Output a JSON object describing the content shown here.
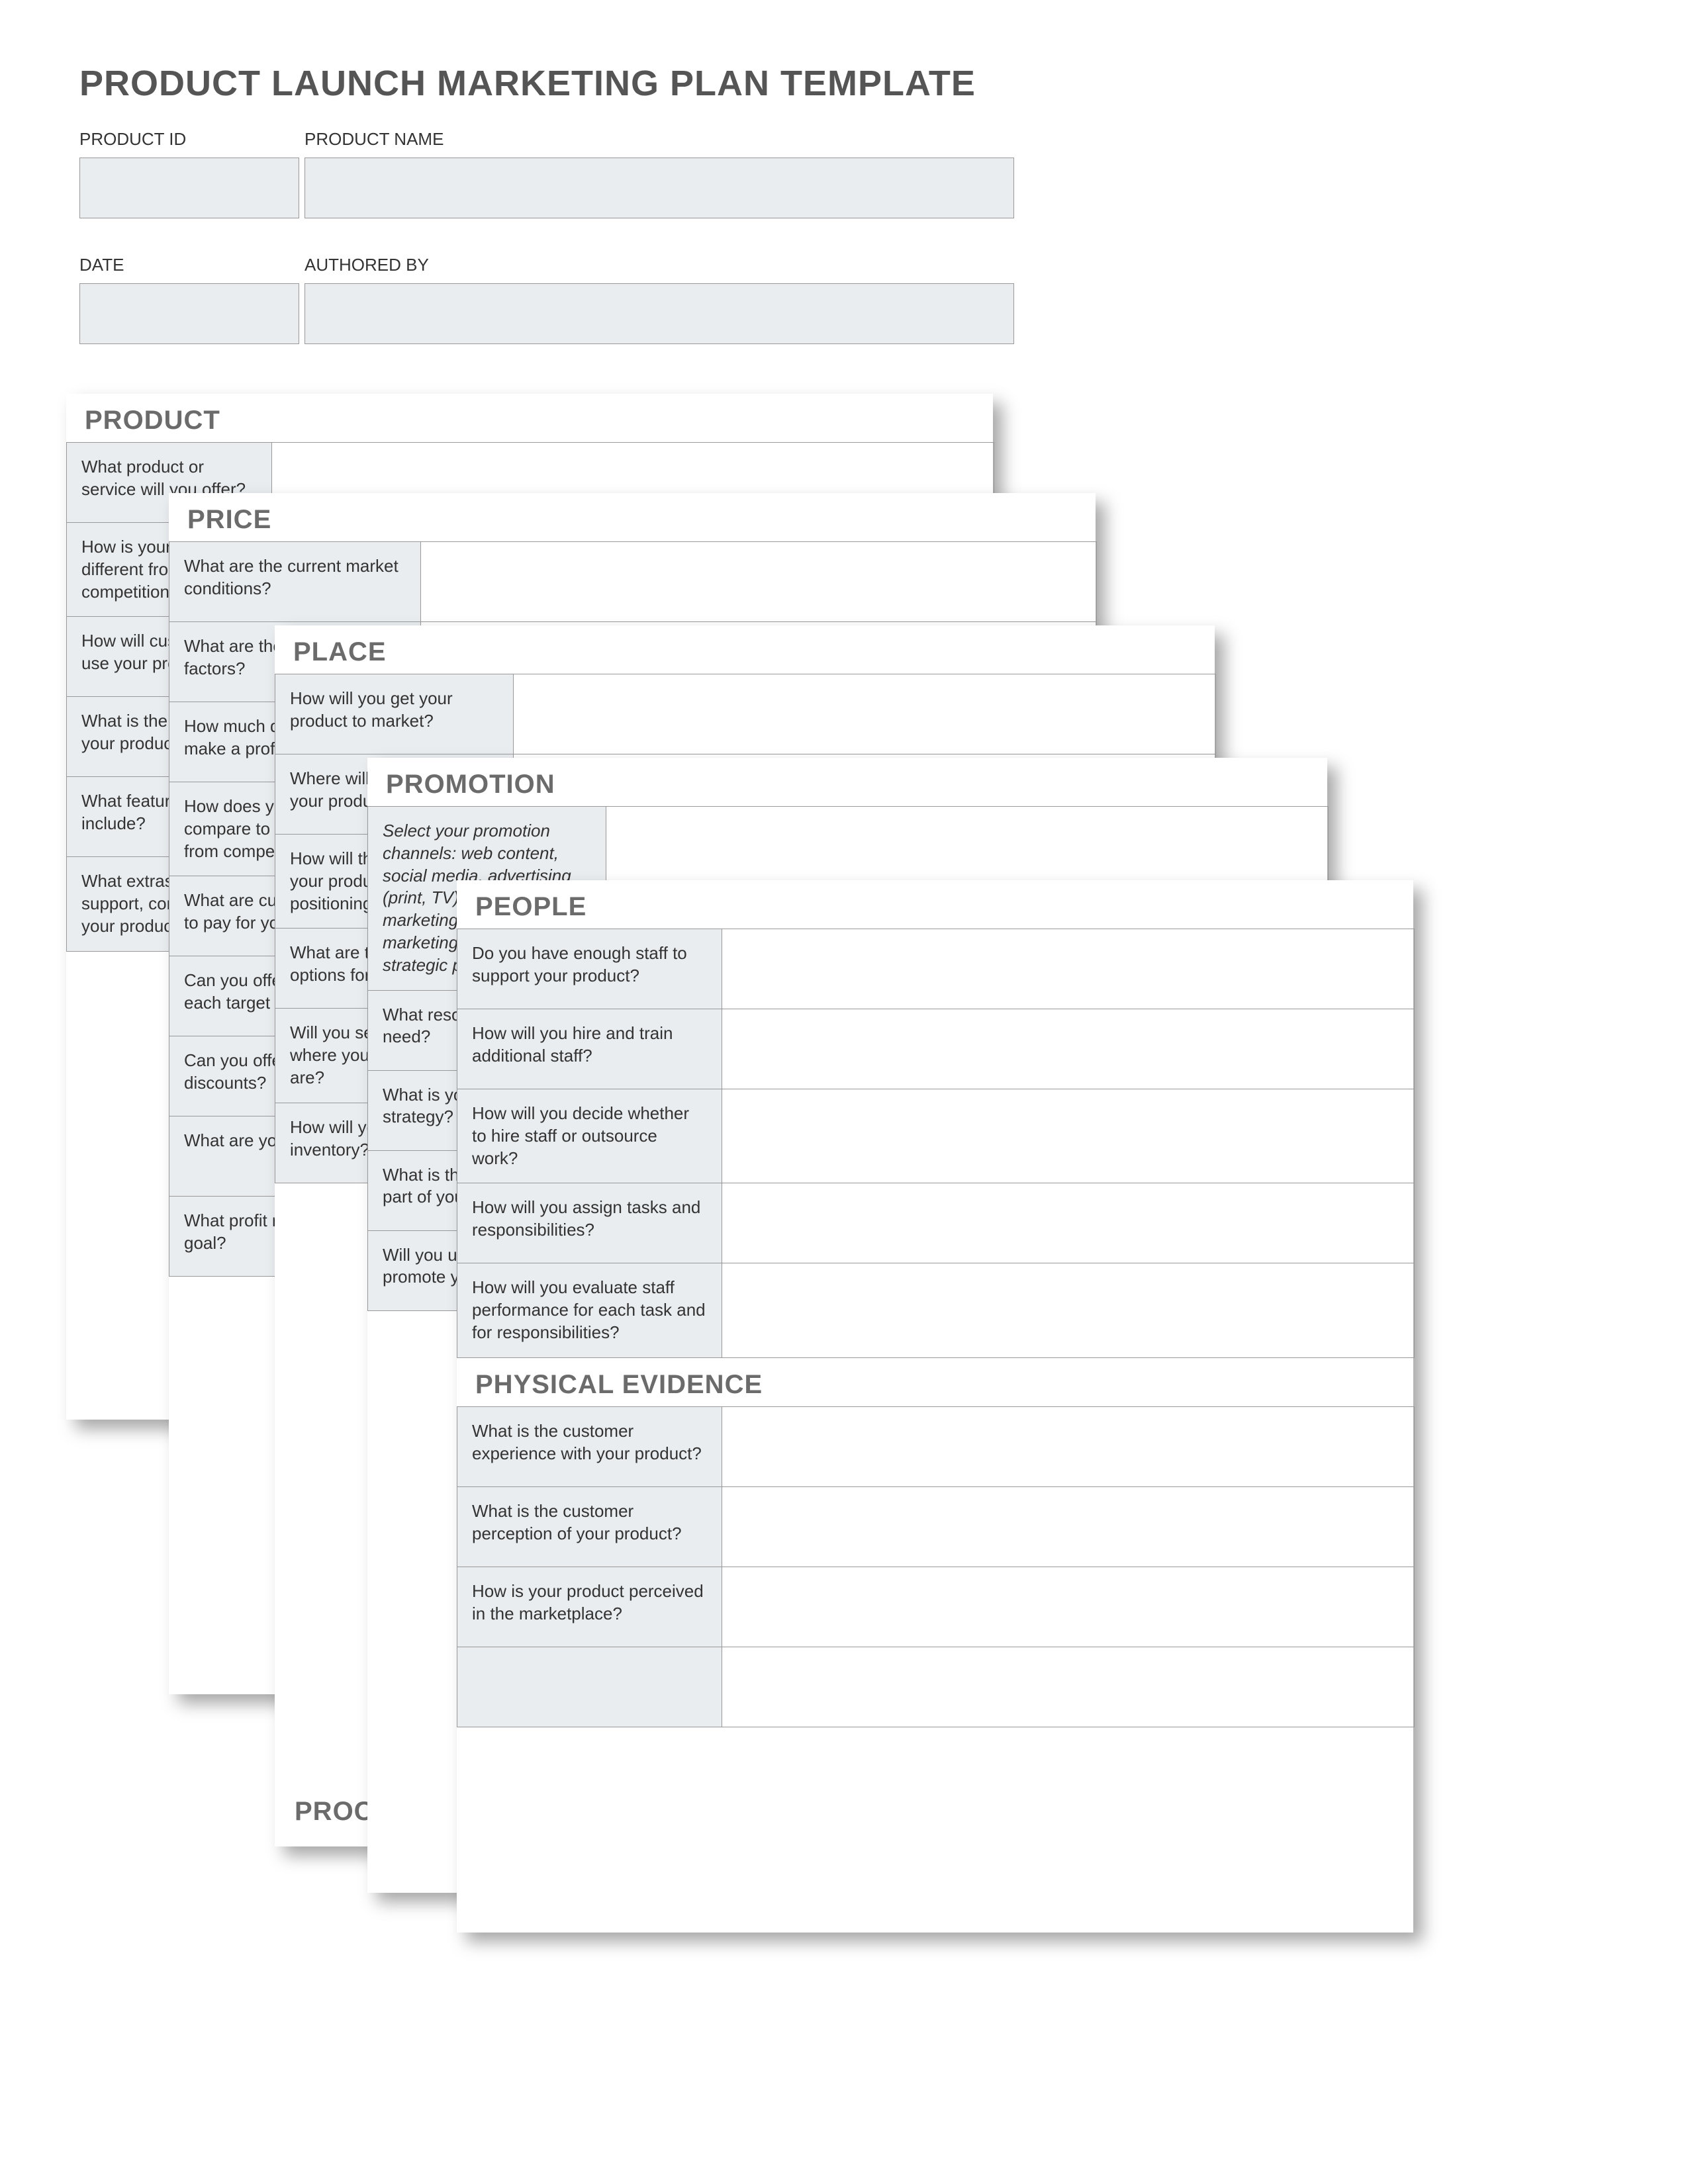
{
  "title": "PRODUCT LAUNCH MARKETING PLAN TEMPLATE",
  "meta": {
    "product_id_label": "PRODUCT ID",
    "product_name_label": "PRODUCT NAME",
    "date_label": "DATE",
    "authored_by_label": "AUTHORED BY",
    "product_id": "",
    "product_name": "",
    "date": "",
    "authored_by": ""
  },
  "sheets": {
    "product": {
      "heading": "PRODUCT",
      "rows": [
        "What product or service will you offer?",
        "How is your product different from the competition?",
        "How will customers use your product?",
        "What is the value of your product?",
        "What features will you include?",
        "What extras, such as support, come with your product?"
      ]
    },
    "price": {
      "heading": "PRICE",
      "rows": [
        "What are the current market conditions?",
        "What are the economic factors?",
        "How much do you need to make a profit?",
        "How does your price compare to similar products from competitors?",
        "What are customers willing to pay for your product?",
        "Can you offer one price for each target market?",
        "Can you offer coupons or discounts?",
        "What are your costs?",
        "What profit margin is your goal?"
      ]
    },
    "place": {
      "heading": "PLACE",
      "rows": [
        "How will you get your product to market?",
        "Where will customers find your product?",
        "How will the location of your product reflect its positioning?",
        "What are the delivery options for your product?",
        "Will you sell online or where your customers are?",
        "How will you manage inventory?"
      ]
    },
    "process": {
      "heading": "PROCESS"
    },
    "promotion": {
      "heading": "PROMOTION",
      "rows": [
        "Select your promotion channels: web content, social media, advertising (print, TV), email marketing, direct marketing, SEO, other, strategic partnerships",
        "What resources do you need?",
        "What is your content strategy?",
        "What is the most important part of your promotion?",
        "Will you use influencers to promote your product?"
      ]
    },
    "people": {
      "heading": "PEOPLE",
      "rows": [
        "Do you have enough staff to support your product?",
        "How will you hire and train additional staff?",
        "How will you decide whether to hire staff or outsource work?",
        "How will you assign tasks and responsibilities?",
        "How will you evaluate staff performance for each task and for responsibilities?"
      ]
    },
    "physical_evidence": {
      "heading": "PHYSICAL EVIDENCE",
      "rows": [
        "What is the customer experience with your product?",
        "What is the customer perception of your product?",
        "How is your product perceived in the marketplace?"
      ]
    }
  }
}
